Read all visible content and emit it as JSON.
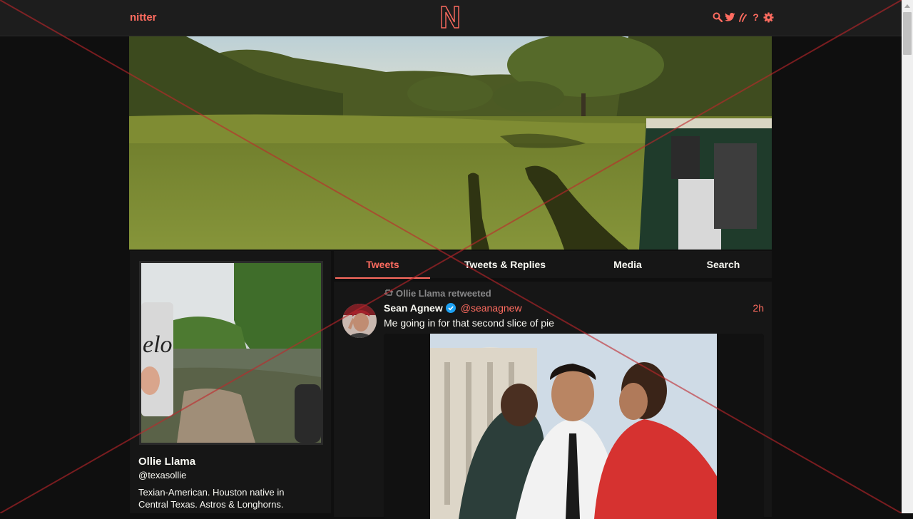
{
  "navbar": {
    "brand": "nitter",
    "logo_letter": "N",
    "icons": [
      "search-icon",
      "twitter-bird-icon",
      "rss-icon",
      "help-icon",
      "gear-icon"
    ],
    "help_glyph": "?"
  },
  "colors": {
    "accent": "#ff6c60",
    "background": "#0f0f0f",
    "panel": "#161616",
    "text": "#f8f8f2",
    "muted": "#888889",
    "verified": "#1da1f2"
  },
  "profile": {
    "fullname": "Ollie Llama",
    "username": "@texasollie",
    "bio_line1": "Texian-American. Houston native in",
    "bio_line2": "Central Texas.  Astros & Longhorns.",
    "avatar_can_text": "elo"
  },
  "tabs": [
    {
      "label": "Tweets",
      "active": true
    },
    {
      "label": "Tweets & Replies",
      "active": false
    },
    {
      "label": "Media",
      "active": false
    },
    {
      "label": "Search",
      "active": false
    }
  ],
  "tweet": {
    "retweet_label": "Ollie Llama retweeted",
    "fullname": "Sean Agnew",
    "verified": true,
    "handle": "@seanagnew",
    "date": "2h",
    "text": "Me going in for that second slice of pie"
  }
}
